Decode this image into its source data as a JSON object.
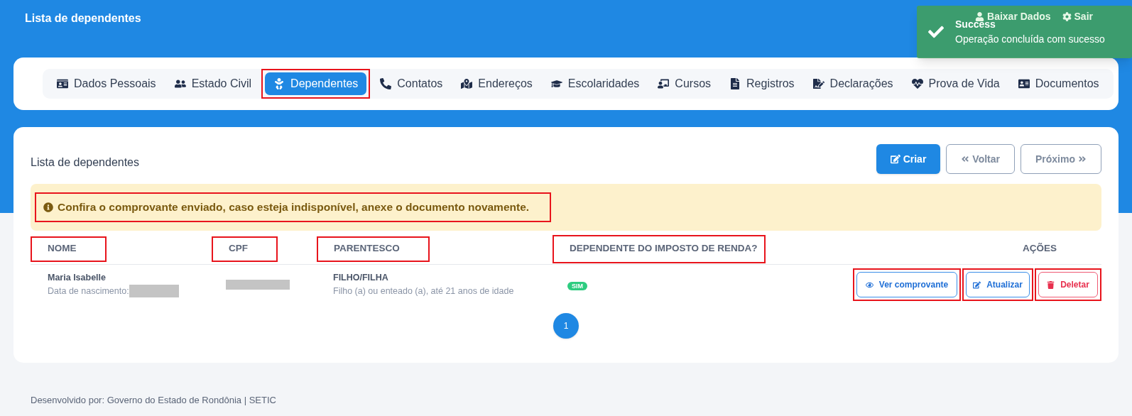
{
  "header": {
    "title": "Lista de dependentes",
    "links": [
      {
        "label": "Baixar Dados",
        "kind": "user"
      },
      {
        "label": "Sair",
        "kind": "gear"
      }
    ]
  },
  "toast": {
    "title": "Success",
    "message": "Operação concluída com sucesso"
  },
  "tabs": [
    {
      "label": "Dados Pessoais",
      "kind": "id",
      "selected": false,
      "highlighted": false
    },
    {
      "label": "Estado Civil",
      "kind": "couple",
      "selected": false,
      "highlighted": false
    },
    {
      "label": "Dependentes",
      "kind": "baby",
      "selected": true,
      "highlighted": true
    },
    {
      "label": "Contatos",
      "kind": "phone",
      "selected": false,
      "highlighted": false
    },
    {
      "label": "Endereços",
      "kind": "map",
      "selected": false,
      "highlighted": false
    },
    {
      "label": "Escolaridades",
      "kind": "cap",
      "selected": false,
      "highlighted": false
    },
    {
      "label": "Cursos",
      "kind": "teacher",
      "selected": false,
      "highlighted": false
    },
    {
      "label": "Registros",
      "kind": "file",
      "selected": false,
      "highlighted": false
    },
    {
      "label": "Declarações",
      "kind": "signed",
      "selected": false,
      "highlighted": false
    },
    {
      "label": "Prova de Vida",
      "kind": "heart",
      "selected": false,
      "highlighted": false
    },
    {
      "label": "Documentos",
      "kind": "card",
      "selected": false,
      "highlighted": false
    }
  ],
  "panel": {
    "title": "Lista de dependentes",
    "buttons": [
      {
        "label": "Criar",
        "kind": "create"
      },
      {
        "label": "Voltar",
        "kind": "back"
      },
      {
        "label": "Próximo",
        "kind": "next"
      }
    ],
    "alert": {
      "text": "Confira o comprovante enviado, caso esteja indisponível, anexe o documento novamente.",
      "highlighted": true
    },
    "table": {
      "columns": [
        {
          "label": "NOME",
          "highlighted": true
        },
        {
          "label": "CPF",
          "highlighted": true
        },
        {
          "label": "PARENTESCO",
          "highlighted": true
        },
        {
          "label": "DEPENDENTE DO IMPOSTO DE RENDA?",
          "highlighted": true
        },
        {
          "label": "AÇÕES",
          "highlighted": false
        }
      ],
      "rows": [
        {
          "name": "Maria Isabelle",
          "birth_label": "Data de nascimento:",
          "relation": "FILHO/FILHA",
          "relation_note": "Filho (a) ou enteado (a), até 21 anos de idade",
          "ir_badge": "SIM",
          "actions": [
            {
              "label": "Ver comprovante",
              "kind": "view",
              "highlighted": true
            },
            {
              "label": "Atualizar",
              "kind": "edit",
              "highlighted": true
            },
            {
              "label": "Deletar",
              "kind": "delete",
              "highlighted": true
            }
          ]
        }
      ]
    },
    "pagination": [
      {
        "label": "1",
        "selected": true
      }
    ]
  },
  "footer": "Desenvolvido por: Governo do Estado de Rondônia | SETIC"
}
